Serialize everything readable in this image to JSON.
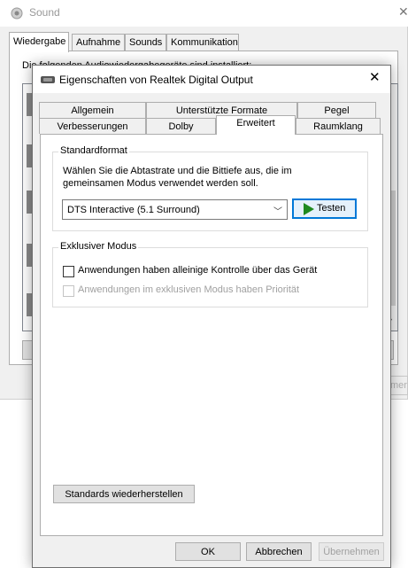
{
  "sound_window": {
    "title": "Sound",
    "tabs": [
      "Wiedergabe",
      "Aufnahme",
      "Sounds",
      "Kommunikation"
    ],
    "active_tab": "Wiedergabe",
    "description": "Die folgenden Audiowiedergabegeräte sind installiert:",
    "side_button_fragment": "men"
  },
  "dialog": {
    "title": "Eigenschaften von Realtek Digital Output",
    "tabs_row1": [
      "Allgemein",
      "Unterstützte Formate",
      "Pegel"
    ],
    "tabs_row2": [
      "Verbesserungen",
      "Dolby",
      "Erweitert",
      "Raumklang"
    ],
    "active_tab": "Erweitert",
    "standard_format": {
      "group_label": "Standardformat",
      "description": "Wählen Sie die Abtastrate und die Bittiefe aus, die im gemeinsamen Modus verwendet werden soll.",
      "selected_value": "DTS Interactive (5.1 Surround)",
      "test_button": "Testen"
    },
    "exclusive_mode": {
      "group_label": "Exklusiver Modus",
      "option1": {
        "label": "Anwendungen haben alleinige Kontrolle über das Gerät",
        "checked": false,
        "enabled": true
      },
      "option2": {
        "label": "Anwendungen im exklusiven Modus haben Priorität",
        "checked": false,
        "enabled": false
      }
    },
    "restore_defaults_button": "Standards wiederherstellen",
    "buttons": {
      "ok": "OK",
      "cancel": "Abbrechen",
      "apply": "Übernehmen"
    }
  },
  "colors": {
    "accent": "#0078d7",
    "play_green": "#1f8a1f",
    "disabled_text": "#a0a0a0"
  }
}
